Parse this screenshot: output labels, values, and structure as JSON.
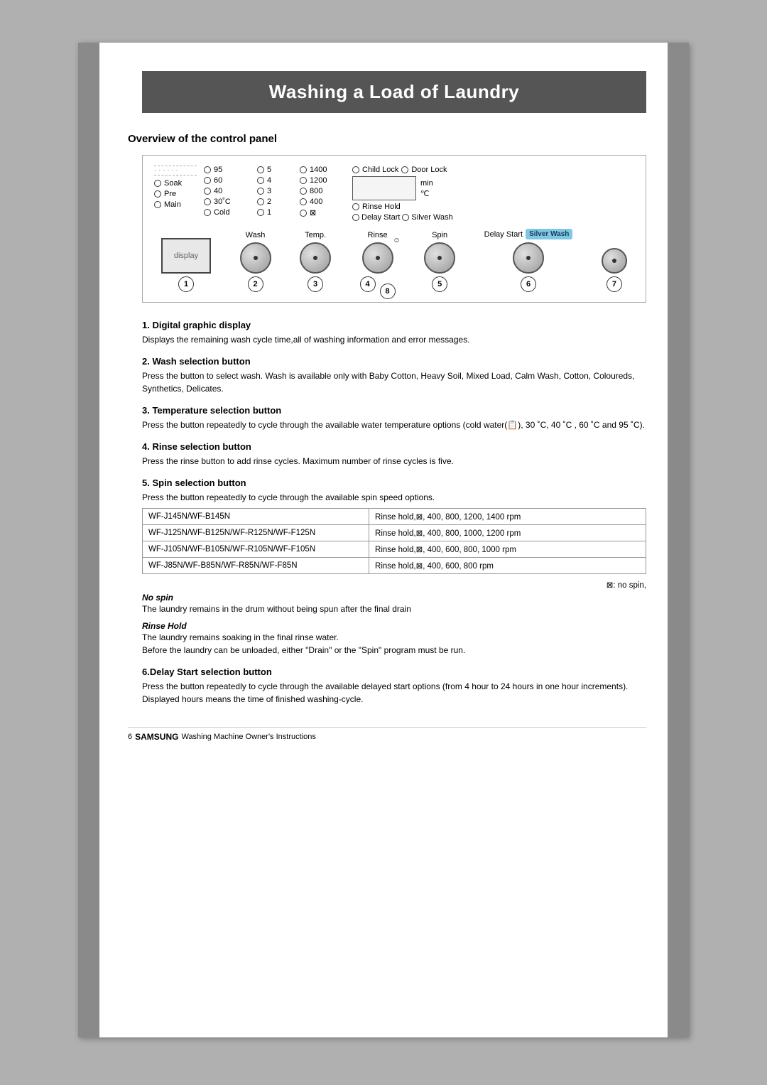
{
  "page": {
    "title": "Washing a Load of Laundry",
    "section_heading": "Overview of the control panel",
    "display": {
      "col1_rows": [
        {
          "icon": "circle",
          "value": "95"
        },
        {
          "icon": "circle",
          "value": "60"
        },
        {
          "icon": "circle",
          "label": "Soak",
          "value": "40"
        },
        {
          "icon": "circle",
          "label": "Pre"
        },
        {
          "icon": "circle",
          "label": "Main"
        }
      ],
      "col2_rows": [
        {
          "icon": "circle",
          "value": "5"
        },
        {
          "icon": "circle",
          "value": "4"
        },
        {
          "icon": "circle",
          "value": "3"
        },
        {
          "icon": "circle",
          "value": "30˚C"
        },
        {
          "icon": "circle",
          "label": "Cold"
        }
      ],
      "col3_rows": [
        {
          "icon": "circle",
          "value": "1400"
        },
        {
          "icon": "circle",
          "value": "1200"
        },
        {
          "icon": "circle",
          "value": "800"
        },
        {
          "icon": "circle",
          "value": "400"
        },
        {
          "icon": "circle",
          "value": "⊠"
        }
      ],
      "col4_rows": [
        {
          "text": "Child Lock  Door Lock"
        },
        {
          "text": "min"
        },
        {
          "text": "℃"
        },
        {
          "text": "Rinse Hold"
        },
        {
          "text": "Delay Start  Silver Wash"
        }
      ]
    },
    "knobs": [
      {
        "label": "Wash",
        "number": "2"
      },
      {
        "label": "Temp.",
        "number": "3"
      },
      {
        "label": "Rinse",
        "number": "4"
      },
      {
        "label": "Spin",
        "number": "5"
      },
      {
        "label": "Delay Start",
        "number": "6"
      },
      {
        "label": "Silver Wash",
        "number": "7"
      }
    ],
    "display_number": "1",
    "items": [
      {
        "number": "1",
        "heading": "Digital graphic display",
        "text": "Displays the remaining wash cycle time,all of washing information and error messages."
      },
      {
        "number": "2",
        "heading": "Wash selection button",
        "text": "Press the button to select wash. Wash is available only with Baby Cotton, Heavy Soil, Mixed Load, Calm Wash, Cotton, Coloureds, Synthetics, Delicates."
      },
      {
        "number": "3",
        "heading": "Temperature selection button",
        "text": "Press the button  repeatedly to cycle through the available water temperature options (cold water(🖐), 30 ˚C, 40 ˚C , 60 ˚C and 95 ˚C)."
      },
      {
        "number": "4",
        "heading": "Rinse selection button",
        "text": "Press the rinse button to add rinse cycles. Maximum number of rinse cycles is five."
      },
      {
        "number": "5",
        "heading": "Spin selection button",
        "text": "Press the button repeatedly to cycle through the available spin speed options."
      }
    ],
    "spin_table": {
      "rows": [
        {
          "model": "WF-J145N/WF-B145N",
          "speeds": "Rinse hold,⊠, 400, 800, 1200, 1400 rpm"
        },
        {
          "model": "WF-J125N/WF-B125N/WF-R125N/WF-F125N",
          "speeds": "Rinse hold,⊠, 400, 800, 1000, 1200 rpm"
        },
        {
          "model": "WF-J105N/WF-B105N/WF-R105N/WF-F105N",
          "speeds": "Rinse hold,⊠, 400, 600, 800, 1000 rpm"
        },
        {
          "model": "WF-J85N/WF-B85N/WF-R85N/WF-F85N",
          "speeds": "Rinse hold,⊠, 400, 600, 800 rpm"
        }
      ]
    },
    "no_spin_note": "⊠: no spin,",
    "no_spin_heading": "No spin",
    "no_spin_text": "The laundry remains in the drum without being spun after the final drain",
    "rinse_hold_heading": "Rinse Hold",
    "rinse_hold_text1": "The laundry remains soaking in the final rinse water.",
    "rinse_hold_text2": "Before the laundry can be unloaded, either \"Drain\" or the \"Spin\" program must be run.",
    "item6": {
      "heading": "6.Delay Start selection button",
      "text": "Press the button repeatedly to cycle through the available delayed start options (from 4 hour to 24 hours in one hour increments).\nDisplayed hours means the time of finished washing-cycle."
    },
    "footer": {
      "number": "6",
      "brand": "SAMSUNG",
      "text": "Washing Machine Owner's Instructions"
    }
  }
}
